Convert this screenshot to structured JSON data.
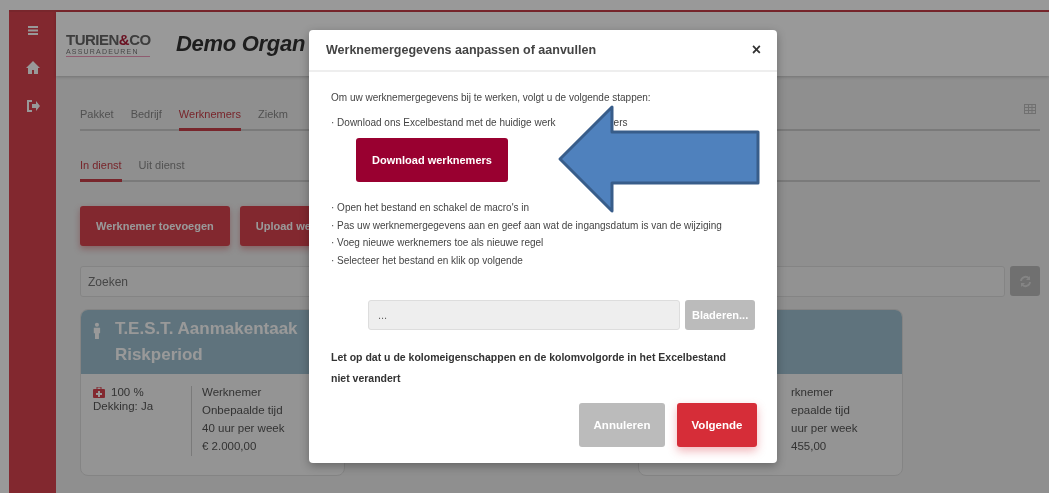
{
  "header": {
    "logo": {
      "parts": [
        "TURIEN",
        "&",
        "CO"
      ],
      "tagline": "ASSURADEUREN"
    },
    "title": "Demo Organ"
  },
  "tabs": [
    {
      "label": "Pakket",
      "selected": false
    },
    {
      "label": "Bedrijf",
      "selected": false
    },
    {
      "label": "Werknemers",
      "selected": true
    },
    {
      "label": "Ziekm",
      "selected": false
    }
  ],
  "subtabs": [
    {
      "label": "In dienst",
      "selected": true
    },
    {
      "label": "Uit dienst",
      "selected": false
    }
  ],
  "actions": [
    "Werknemer toevoegen",
    "Upload we"
  ],
  "search": {
    "placeholder": "Zoeken"
  },
  "cards": [
    {
      "title": "T.E.S.T. Aanmakentaak Riskperiod",
      "percentage": "100 %",
      "coverage": "Dekking: Ja",
      "details": [
        "Werknemer",
        "Onbepaalde tijd",
        "40 uur per week",
        "€ 2.000,00"
      ]
    },
    {
      "details": [
        "rknemer",
        "epaalde tijd",
        "uur per week",
        "455,00"
      ]
    }
  ],
  "dialog": {
    "title": "Werknemergegevens aanpassen of aanvullen",
    "close": "×",
    "intro": "Om uw werknemergegevens bij te werken, volgt u de volgende stappen:",
    "download_step": [
      "· Download ons Excelbestand met de huidige werk",
      "ers"
    ],
    "download_button": "Download werknemers",
    "steps": [
      "· Open het bestand en schakel de macro's in",
      "· Pas uw werknemergegevens aan en geef aan wat de ingangsdatum is van de wijziging",
      "· Voeg nieuwe werknemers toe als nieuwe regel",
      "· Selecteer het bestand en klik op volgende"
    ],
    "file_field": {
      "value": "..."
    },
    "browse_button": "Bladeren...",
    "note": "Let op dat u de kolomeigenschappen en de kolomvolgorde in het Excelbestand niet verandert",
    "buttons": [
      {
        "label": "Annuleren",
        "kind": "secondary"
      },
      {
        "label": "Volgende",
        "kind": "primary"
      }
    ]
  }
}
